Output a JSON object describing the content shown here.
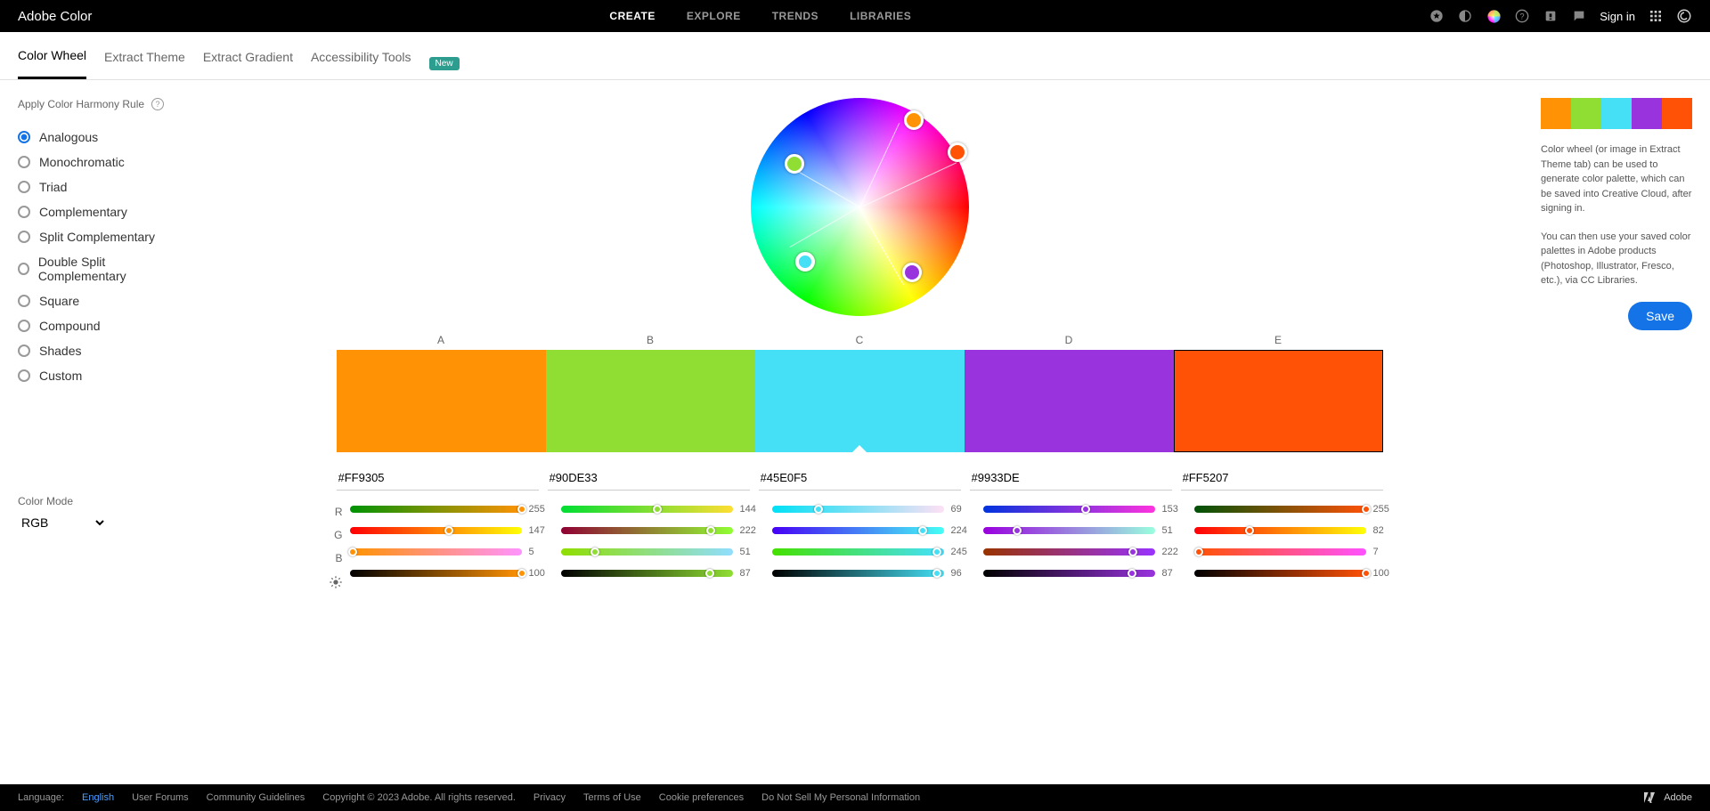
{
  "app": {
    "name": "Adobe Color"
  },
  "topnav": {
    "create": "CREATE",
    "explore": "EXPLORE",
    "trends": "TRENDS",
    "libraries": "LIBRARIES"
  },
  "signin": "Sign in",
  "subnav": {
    "wheel": "Color Wheel",
    "extract_theme": "Extract Theme",
    "extract_gradient": "Extract Gradient",
    "accessibility": "Accessibility Tools",
    "new": "New"
  },
  "harmony": {
    "label": "Apply Color Harmony Rule",
    "options": [
      "Analogous",
      "Monochromatic",
      "Triad",
      "Complementary",
      "Split Complementary",
      "Double Split Complementary",
      "Square",
      "Compound",
      "Shades",
      "Custom"
    ],
    "selected": 0
  },
  "color_mode": {
    "label": "Color Mode",
    "value": "RGB"
  },
  "swatches": {
    "labels": [
      "A",
      "B",
      "C",
      "D",
      "E"
    ],
    "colors": [
      "#FF9305",
      "#90DE33",
      "#45E0F5",
      "#9933DE",
      "#FF5207"
    ],
    "active_index": 2,
    "selected_index": 4,
    "rgb": [
      {
        "r": 255,
        "g": 147,
        "b": 5,
        "bright": 100
      },
      {
        "r": 144,
        "g": 222,
        "b": 51,
        "bright": 87
      },
      {
        "r": 69,
        "g": 224,
        "b": 245,
        "bright": 96
      },
      {
        "r": 153,
        "g": 51,
        "b": 222,
        "bright": 87
      },
      {
        "r": 255,
        "g": 82,
        "b": 7,
        "bright": 100
      }
    ]
  },
  "slider_channels": [
    "R",
    "G",
    "B"
  ],
  "right": {
    "p1": "Color wheel (or image in Extract Theme tab) can be used to generate color palette, which can be saved into Creative Cloud, after signing in.",
    "p2": "You can then use your saved color palettes in Adobe products (Photoshop, Illustrator, Fresco, etc.), via CC Libraries.",
    "save": "Save"
  },
  "footer": {
    "language_label": "Language:",
    "language": "English",
    "forums": "User Forums",
    "guidelines": "Community Guidelines",
    "copyright": "Copyright © 2023 Adobe. All rights reserved.",
    "privacy": "Privacy",
    "terms": "Terms of Use",
    "cookies": "Cookie preferences",
    "dns": "Do Not Sell My Personal Information",
    "adobe": "Adobe"
  }
}
